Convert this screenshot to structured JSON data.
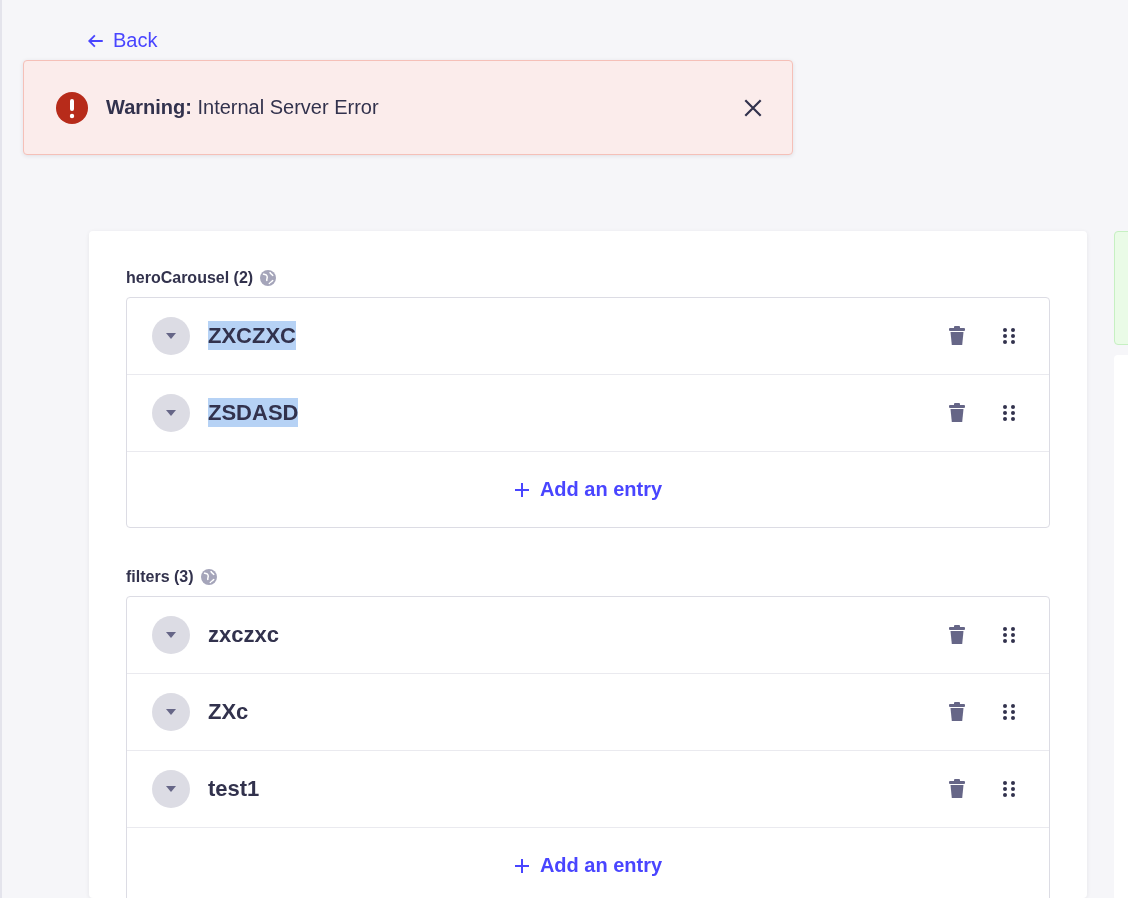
{
  "back_link": {
    "label": "Back"
  },
  "toast": {
    "kind": "warning",
    "title": "Warning:",
    "message": "Internal Server Error"
  },
  "groups": [
    {
      "label": "heroCarousel (2)",
      "add_label": "Add an entry",
      "entries": [
        {
          "title": "ZXCZXC",
          "highlighted": true
        },
        {
          "title": "ZSDASD",
          "highlighted": true
        }
      ]
    },
    {
      "label": "filters (3)",
      "add_label": "Add an entry",
      "entries": [
        {
          "title": "zxczxc",
          "highlighted": false
        },
        {
          "title": "ZXc",
          "highlighted": false
        },
        {
          "title": "test1",
          "highlighted": false
        }
      ]
    }
  ]
}
